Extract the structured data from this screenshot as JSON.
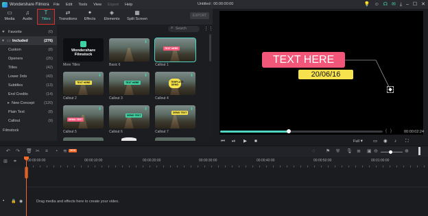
{
  "titlebar": {
    "app_name": "Wondershare Filmora",
    "menu": [
      "File",
      "Edit",
      "Tools",
      "View",
      "Export",
      "Help"
    ],
    "document_title": "Untitled : 00:00:00:00"
  },
  "modules": {
    "tabs": [
      {
        "label": "Media",
        "icon": "folder-icon"
      },
      {
        "label": "Audio",
        "icon": "music-note-icon"
      },
      {
        "label": "Titles",
        "icon": "text-t-icon",
        "active": true
      },
      {
        "label": "Transitions",
        "icon": "transition-icon"
      },
      {
        "label": "Effects",
        "icon": "effects-icon"
      },
      {
        "label": "Elements",
        "icon": "elements-icon"
      },
      {
        "label": "Split Screen",
        "icon": "split-screen-icon"
      }
    ],
    "export_label": "EXPORT"
  },
  "sidebar": {
    "items": [
      {
        "label": "Favorite",
        "count": "(0)",
        "icon": "heart-icon"
      },
      {
        "label": "Included",
        "count": "(276)",
        "selected": true,
        "icon": "folder-icon"
      },
      {
        "label": "Custom",
        "count": "(8)"
      },
      {
        "label": "Openers",
        "count": "(25)"
      },
      {
        "label": "Titles",
        "count": "(42)"
      },
      {
        "label": "Lower 3rds",
        "count": "(43)"
      },
      {
        "label": "Subtitles",
        "count": "(13)"
      },
      {
        "label": "End Credits",
        "count": "(14)"
      },
      {
        "label": "New Concept",
        "count": "(120)"
      },
      {
        "label": "Plain Text",
        "count": "(8)"
      },
      {
        "label": "Callout",
        "count": "(9)"
      }
    ],
    "filmstock_label": "Filmstock"
  },
  "library": {
    "search_placeholder": "Search",
    "tiles": [
      {
        "label": "More Titles",
        "filmstock_text": "Wondershare Filmstock"
      },
      {
        "label": "Basic 6"
      },
      {
        "label": "Callout 1",
        "caption": "TEXT HERE",
        "selected": true
      },
      {
        "label": "Callout 2",
        "caption": "TEXT HERE"
      },
      {
        "label": "Callout 3",
        "caption": "TEXT HERE"
      },
      {
        "label": "Callout 4",
        "caption": "TEMPLATE DEMO"
      },
      {
        "label": "Callout 5",
        "caption": "DEMO TEXT"
      },
      {
        "label": "Callout 6",
        "caption": "DEMO TEXT"
      },
      {
        "label": "Callout 7",
        "caption": "DEMO TEXT"
      }
    ]
  },
  "preview": {
    "title_text": "TEXT HERE",
    "date_text": "20/06/16",
    "time": "00:00:02:24",
    "quality": "Full",
    "progress": 0.42,
    "colors": {
      "title_pill": "#f2577a",
      "date_pill": "#f5e24c",
      "accent": "#4fd8c4"
    }
  },
  "timeline": {
    "ruler": [
      "00:00:00:00",
      "00:00:10:00",
      "00:00:20:00",
      "00:00:30:00",
      "00:00:40:00",
      "00:00:50:00",
      "00:01:00:00"
    ],
    "new_badge": "NEW",
    "drop_hint": "Drag media and effects here to create your video."
  }
}
